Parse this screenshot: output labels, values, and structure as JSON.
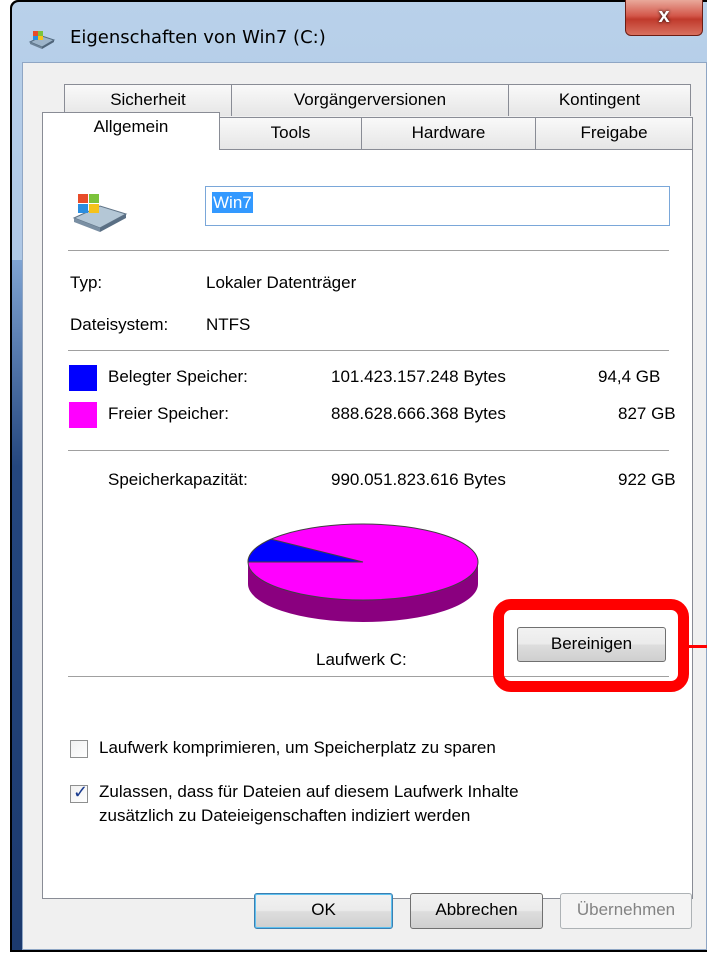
{
  "window": {
    "title": "Eigenschaften von Win7 (C:)",
    "close_label": "x"
  },
  "tabs": {
    "row1": [
      "Sicherheit",
      "Vorgängerversionen",
      "Kontingent"
    ],
    "row2": [
      "Allgemein",
      "Tools",
      "Hardware",
      "Freigabe"
    ],
    "active": "Allgemein"
  },
  "general": {
    "drive_name": "Win7",
    "type_label": "Typ:",
    "type_value": "Lokaler Datenträger",
    "fs_label": "Dateisystem:",
    "fs_value": "NTFS",
    "used_label": "Belegter Speicher:",
    "used_bytes": "101.423.157.248 Bytes",
    "used_size": "94,4 GB",
    "free_label": "Freier Speicher:",
    "free_bytes": "888.628.666.368 Bytes",
    "free_size": "827 GB",
    "capacity_label": "Speicherkapazität:",
    "capacity_bytes": "990.051.823.616 Bytes",
    "capacity_size": "922 GB",
    "drive_label": "Laufwerk C:",
    "cleanup_button": "Bereinigen",
    "compress_label": "Laufwerk komprimieren, um Speicherplatz zu sparen",
    "compress_checked": false,
    "index_label_line1": "Zulassen, dass für Dateien auf diesem Laufwerk Inhalte",
    "index_label_line2": "zusätzlich zu Dateieigenschaften indiziert werden",
    "index_checked": true
  },
  "colors": {
    "used": "#0000ff",
    "free": "#ff00ff",
    "highlight": "#ff0000"
  },
  "chart_data": {
    "type": "pie",
    "categories": [
      "Belegter Speicher",
      "Freier Speicher"
    ],
    "values": [
      101423157248,
      888628666368
    ],
    "colors": [
      "#0000ff",
      "#ff00ff"
    ]
  },
  "footer": {
    "ok": "OK",
    "cancel": "Abbrechen",
    "apply": "Übernehmen"
  }
}
